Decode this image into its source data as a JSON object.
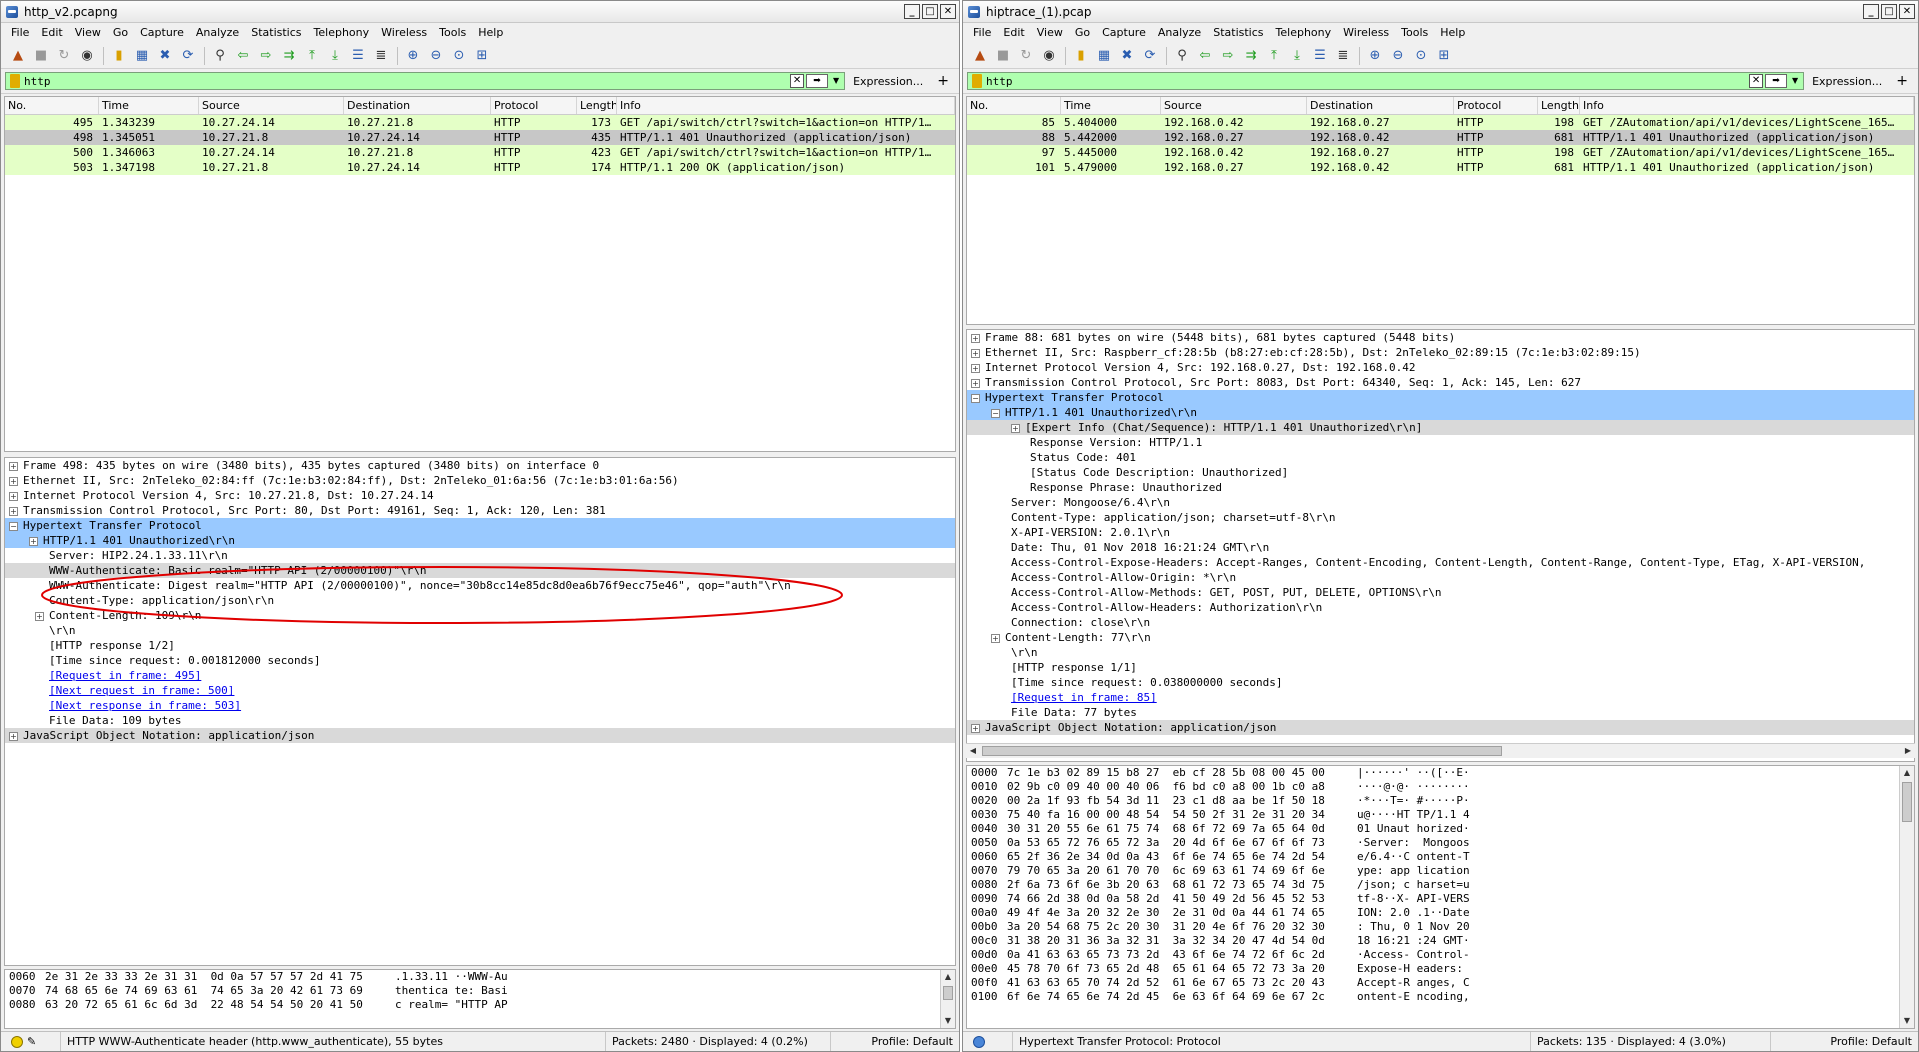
{
  "menu": [
    "File",
    "Edit",
    "View",
    "Go",
    "Capture",
    "Analyze",
    "Statistics",
    "Telephony",
    "Wireless",
    "Tools",
    "Help"
  ],
  "toolbar_icons": [
    "shark-fin-icon",
    "stop-icon",
    "restart-icon",
    "options-icon",
    "open-icon",
    "save-icon",
    "close-file-icon",
    "reload-icon",
    "find-icon",
    "back-icon",
    "forward-icon",
    "goto-icon",
    "first-icon",
    "last-icon",
    "autoscroll-icon",
    "colorize-icon",
    "zoom-in-icon",
    "zoom-out-icon",
    "zoom-reset-icon",
    "resize-columns-icon"
  ],
  "columns": [
    "No.",
    "Time",
    "Source",
    "Destination",
    "Protocol",
    "Length",
    "Info"
  ],
  "colors": {
    "filter_bg": "#afffaf",
    "http_row": "#e4ffc7",
    "selected_row": "#c7c7c7",
    "highlight": "#99c9ff",
    "annotation": "#e00000"
  },
  "left": {
    "title": "http_v2.pcapng",
    "filter": "http",
    "expression_label": "Expression...",
    "packets": [
      {
        "no": "495",
        "time": "1.343239",
        "src": "10.27.24.14",
        "dst": "10.27.21.8",
        "proto": "HTTP",
        "len": "173",
        "info": "GET /api/switch/ctrl?switch=1&action=on HTTP/1…"
      },
      {
        "no": "498",
        "time": "1.345051",
        "src": "10.27.21.8",
        "dst": "10.27.24.14",
        "proto": "HTTP",
        "len": "435",
        "info": "HTTP/1.1 401 Unauthorized  (application/json)"
      },
      {
        "no": "500",
        "time": "1.346063",
        "src": "10.27.24.14",
        "dst": "10.27.21.8",
        "proto": "HTTP",
        "len": "423",
        "info": "GET /api/switch/ctrl?switch=1&action=on HTTP/1…"
      },
      {
        "no": "503",
        "time": "1.347198",
        "src": "10.27.21.8",
        "dst": "10.27.24.14",
        "proto": "HTTP",
        "len": "174",
        "info": "HTTP/1.1 200 OK  (application/json)"
      }
    ],
    "details": [
      {
        "text": "Frame 498: 435 bytes on wire (3480 bits), 435 bytes captured (3480 bits) on interface 0"
      },
      {
        "text": "Ethernet II, Src: 2nTeleko_02:84:ff (7c:1e:b3:02:84:ff), Dst: 2nTeleko_01:6a:56 (7c:1e:b3:01:6a:56)"
      },
      {
        "text": "Internet Protocol Version 4, Src: 10.27.21.8, Dst: 10.27.24.14"
      },
      {
        "text": "Transmission Control Protocol, Src Port: 80, Dst Port: 49161, Seq: 1, Ack: 120, Len: 381"
      },
      {
        "text": "Hypertext Transfer Protocol"
      },
      {
        "text": "HTTP/1.1 401 Unauthorized\\r\\n"
      },
      {
        "text": "Server: HIP2.24.1.33.11\\r\\n"
      },
      {
        "text": "WWW-Authenticate: Basic realm=\"HTTP API (2/00000100)\"\\r\\n"
      },
      {
        "text": "WWW-Authenticate: Digest realm=\"HTTP API (2/00000100)\", nonce=\"30b8cc14e85dc8d0ea6b76f9ecc75e46\", qop=\"auth\"\\r\\n"
      },
      {
        "text": "Content-Type: application/json\\r\\n"
      },
      {
        "text": "Content-Length: 109\\r\\n"
      },
      {
        "text": "\\r\\n"
      },
      {
        "text": "[HTTP response 1/2]"
      },
      {
        "text": "[Time since request: 0.001812000 seconds]"
      },
      {
        "text": "[Request in frame: 495]"
      },
      {
        "text": "[Next request in frame: 500]"
      },
      {
        "text": "[Next response in frame: 503]"
      },
      {
        "text": "File Data: 109 bytes"
      },
      {
        "text": "JavaScript Object Notation: application/json"
      }
    ],
    "hex": [
      {
        "off": "0060",
        "bytes": "2e 31 2e 33 33 2e 31 31  0d 0a 57 57 57 2d 41 75",
        "ascii": ".1.33.11 ··WWW-Au"
      },
      {
        "off": "0070",
        "bytes": "74 68 65 6e 74 69 63 61  74 65 3a 20 42 61 73 69",
        "ascii": "thentica te: Basi"
      },
      {
        "off": "0080",
        "bytes": "63 20 72 65 61 6c 6d 3d  22 48 54 54 50 20 41 50",
        "ascii": "c realm= \"HTTP AP"
      }
    ],
    "status_field": "HTTP WWW-Authenticate header (http.www_authenticate), 55 bytes",
    "status_packets": "Packets: 2480 · Displayed: 4 (0.2%)",
    "status_profile": "Profile: Default"
  },
  "right": {
    "title": "hiptrace_(1).pcap",
    "filter": "http",
    "expression_label": "Expression...",
    "packets": [
      {
        "no": "85",
        "time": "5.404000",
        "src": "192.168.0.42",
        "dst": "192.168.0.27",
        "proto": "HTTP",
        "len": "198",
        "info": "GET /ZAutomation/api/v1/devices/LightScene_165…"
      },
      {
        "no": "88",
        "time": "5.442000",
        "src": "192.168.0.27",
        "dst": "192.168.0.42",
        "proto": "HTTP",
        "len": "681",
        "info": "HTTP/1.1 401 Unauthorized  (application/json)"
      },
      {
        "no": "97",
        "time": "5.445000",
        "src": "192.168.0.42",
        "dst": "192.168.0.27",
        "proto": "HTTP",
        "len": "198",
        "info": "GET /ZAutomation/api/v1/devices/LightScene_165…"
      },
      {
        "no": "101",
        "time": "5.479000",
        "src": "192.168.0.27",
        "dst": "192.168.0.42",
        "proto": "HTTP",
        "len": "681",
        "info": "HTTP/1.1 401 Unauthorized  (application/json)"
      }
    ],
    "details": [
      {
        "text": "Frame 88: 681 bytes on wire (5448 bits), 681 bytes captured (5448 bits)"
      },
      {
        "text": "Ethernet II, Src: Raspberr_cf:28:5b (b8:27:eb:cf:28:5b), Dst: 2nTeleko_02:89:15 (7c:1e:b3:02:89:15)"
      },
      {
        "text": "Internet Protocol Version 4, Src: 192.168.0.27, Dst: 192.168.0.42"
      },
      {
        "text": "Transmission Control Protocol, Src Port: 8083, Dst Port: 64340, Seq: 1, Ack: 145, Len: 627"
      },
      {
        "text": "Hypertext Transfer Protocol"
      },
      {
        "text": "HTTP/1.1 401 Unauthorized\\r\\n"
      },
      {
        "text": "[Expert Info (Chat/Sequence): HTTP/1.1 401 Unauthorized\\r\\n]"
      },
      {
        "text": "Response Version: HTTP/1.1"
      },
      {
        "text": "Status Code: 401"
      },
      {
        "text": "[Status Code Description: Unauthorized]"
      },
      {
        "text": "Response Phrase: Unauthorized"
      },
      {
        "text": "Server: Mongoose/6.4\\r\\n"
      },
      {
        "text": "Content-Type: application/json; charset=utf-8\\r\\n"
      },
      {
        "text": "X-API-VERSION: 2.0.1\\r\\n"
      },
      {
        "text": "Date: Thu, 01 Nov 2018 16:21:24 GMT\\r\\n"
      },
      {
        "text": "Access-Control-Expose-Headers: Accept-Ranges, Content-Encoding, Content-Length, Content-Range, Content-Type, ETag, X-API-VERSION,"
      },
      {
        "text": "Access-Control-Allow-Origin: *\\r\\n"
      },
      {
        "text": "Access-Control-Allow-Methods: GET, POST, PUT, DELETE, OPTIONS\\r\\n"
      },
      {
        "text": "Access-Control-Allow-Headers: Authorization\\r\\n"
      },
      {
        "text": "Connection: close\\r\\n"
      },
      {
        "text": "Content-Length: 77\\r\\n"
      },
      {
        "text": "\\r\\n"
      },
      {
        "text": "[HTTP response 1/1]"
      },
      {
        "text": "[Time since request: 0.038000000 seconds]"
      },
      {
        "text": "[Request in frame: 85]"
      },
      {
        "text": "File Data: 77 bytes"
      },
      {
        "text": "JavaScript Object Notation: application/json"
      }
    ],
    "hex": [
      {
        "off": "0000",
        "bytes": "7c 1e b3 02 89 15 b8 27  eb cf 28 5b 08 00 45 00",
        "ascii": "|······' ··([··E·"
      },
      {
        "off": "0010",
        "bytes": "02 9b c0 09 40 00 40 06  f6 bd c0 a8 00 1b c0 a8",
        "ascii": "····@·@· ········"
      },
      {
        "off": "0020",
        "bytes": "00 2a 1f 93 fb 54 3d 11  23 c1 d8 aa be 1f 50 18",
        "ascii": "·*···T=· #·····P·"
      },
      {
        "off": "0030",
        "bytes": "75 40 fa 16 00 00 48 54  54 50 2f 31 2e 31 20 34",
        "ascii": "u@····HT TP/1.1 4"
      },
      {
        "off": "0040",
        "bytes": "30 31 20 55 6e 61 75 74  68 6f 72 69 7a 65 64 0d",
        "ascii": "01 Unaut horized·"
      },
      {
        "off": "0050",
        "bytes": "0a 53 65 72 76 65 72 3a  20 4d 6f 6e 67 6f 6f 73",
        "ascii": "·Server:  Mongoos"
      },
      {
        "off": "0060",
        "bytes": "65 2f 36 2e 34 0d 0a 43  6f 6e 74 65 6e 74 2d 54",
        "ascii": "e/6.4··C ontent-T"
      },
      {
        "off": "0070",
        "bytes": "79 70 65 3a 20 61 70 70  6c 69 63 61 74 69 6f 6e",
        "ascii": "ype: app lication"
      },
      {
        "off": "0080",
        "bytes": "2f 6a 73 6f 6e 3b 20 63  68 61 72 73 65 74 3d 75",
        "ascii": "/json; c harset=u"
      },
      {
        "off": "0090",
        "bytes": "74 66 2d 38 0d 0a 58 2d  41 50 49 2d 56 45 52 53",
        "ascii": "tf-8··X- API-VERS"
      },
      {
        "off": "00a0",
        "bytes": "49 4f 4e 3a 20 32 2e 30  2e 31 0d 0a 44 61 74 65",
        "ascii": "ION: 2.0 .1··Date"
      },
      {
        "off": "00b0",
        "bytes": "3a 20 54 68 75 2c 20 30  31 20 4e 6f 76 20 32 30",
        "ascii": ": Thu, 0 1 Nov 20"
      },
      {
        "off": "00c0",
        "bytes": "31 38 20 31 36 3a 32 31  3a 32 34 20 47 4d 54 0d",
        "ascii": "18 16:21 :24 GMT·"
      },
      {
        "off": "00d0",
        "bytes": "0a 41 63 63 65 73 73 2d  43 6f 6e 74 72 6f 6c 2d",
        "ascii": "·Access- Control-"
      },
      {
        "off": "00e0",
        "bytes": "45 78 70 6f 73 65 2d 48  65 61 64 65 72 73 3a 20",
        "ascii": "Expose-H eaders: "
      },
      {
        "off": "00f0",
        "bytes": "41 63 63 65 70 74 2d 52  61 6e 67 65 73 2c 20 43",
        "ascii": "Accept-R anges, C"
      },
      {
        "off": "0100",
        "bytes": "6f 6e 74 65 6e 74 2d 45  6e 63 6f 64 69 6e 67 2c",
        "ascii": "ontent-E ncoding,"
      }
    ],
    "status_field": "Hypertext Transfer Protocol: Protocol",
    "status_packets": "Packets: 135 · Displayed: 4 (3.0%)",
    "status_profile": "Profile: Default"
  }
}
